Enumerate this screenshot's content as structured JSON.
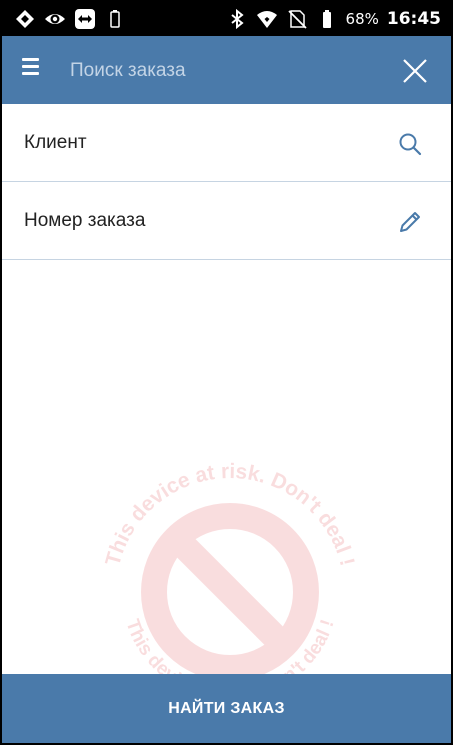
{
  "status_bar": {
    "battery_percent": "68%",
    "time": "16:45",
    "left_icons": [
      "diamond-app-icon",
      "eye-icon",
      "teamviewer-icon",
      "battery-outline-icon"
    ],
    "right_icons": [
      "bluetooth-icon",
      "wifi-icon",
      "no-sim-icon",
      "battery-icon"
    ]
  },
  "app_bar": {
    "search_placeholder": "Поиск заказа",
    "background_color": "#4a7aaa"
  },
  "filters": [
    {
      "label": "Клиент",
      "icon": "search-icon"
    },
    {
      "label": "Номер заказа",
      "icon": "pencil-icon"
    }
  ],
  "watermark": {
    "top_text": "This device at risk. Don't deal !",
    "bottom_text": "This device at risk. Don't deal !"
  },
  "bottom_button": {
    "label": "НАЙТИ ЗАКАЗ"
  }
}
